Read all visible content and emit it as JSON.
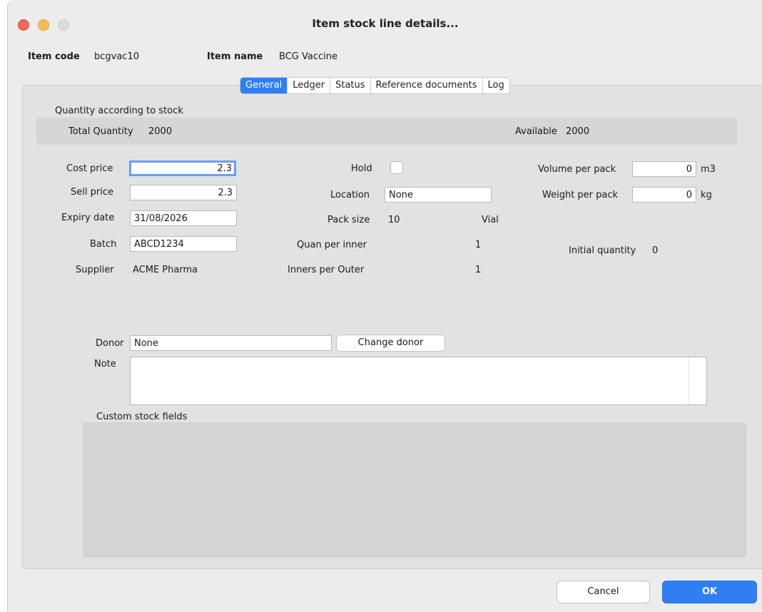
{
  "window": {
    "title": "Item stock line details..."
  },
  "header": {
    "item_code_label": "Item code",
    "item_code_value": "bcgvac10",
    "item_name_label": "Item name",
    "item_name_value": "BCG Vaccine"
  },
  "tabs": [
    {
      "label": "General",
      "active": true
    },
    {
      "label": "Ledger",
      "active": false
    },
    {
      "label": "Status",
      "active": false
    },
    {
      "label": "Reference documents",
      "active": false
    },
    {
      "label": "Log",
      "active": false
    }
  ],
  "quantity": {
    "section_label": "Quantity according to stock",
    "total_label": "Total Quantity",
    "total_value": "2000",
    "available_label": "Available",
    "available_value": "2000"
  },
  "fields": {
    "cost_price": {
      "label": "Cost price",
      "value": "2.3"
    },
    "sell_price": {
      "label": "Sell price",
      "value": "2.3"
    },
    "expiry_date": {
      "label": "Expiry date",
      "value": "31/08/2026"
    },
    "batch": {
      "label": "Batch",
      "value": "ABCD1234"
    },
    "supplier": {
      "label": "Supplier",
      "value": "ACME Pharma"
    },
    "hold": {
      "label": "Hold",
      "checked": false
    },
    "location": {
      "label": "Location",
      "value": "None"
    },
    "pack_size": {
      "label": "Pack size",
      "value": "10",
      "unit": "Vial"
    },
    "quan_per_inner": {
      "label": "Quan per inner",
      "value": "1"
    },
    "inners_per_outer": {
      "label": "Inners per Outer",
      "value": "1"
    },
    "volume_per_pack": {
      "label": "Volume per pack",
      "value": "0",
      "unit": "m3"
    },
    "weight_per_pack": {
      "label": "Weight per pack",
      "value": "0",
      "unit": "kg"
    },
    "initial_quantity": {
      "label": "Initial quantity",
      "value": "0"
    },
    "donor": {
      "label": "Donor",
      "value": "None"
    },
    "note": {
      "label": "Note",
      "value": ""
    }
  },
  "buttons": {
    "change_donor": "Change donor",
    "cancel": "Cancel",
    "ok": "OK"
  },
  "custom_stock_fields_label": "Custom stock fields",
  "colors": {
    "accent": "#2f7ff4",
    "close": "#ed6a5e",
    "minimize": "#f5bf4f",
    "maximize": "#dcdcdc"
  }
}
